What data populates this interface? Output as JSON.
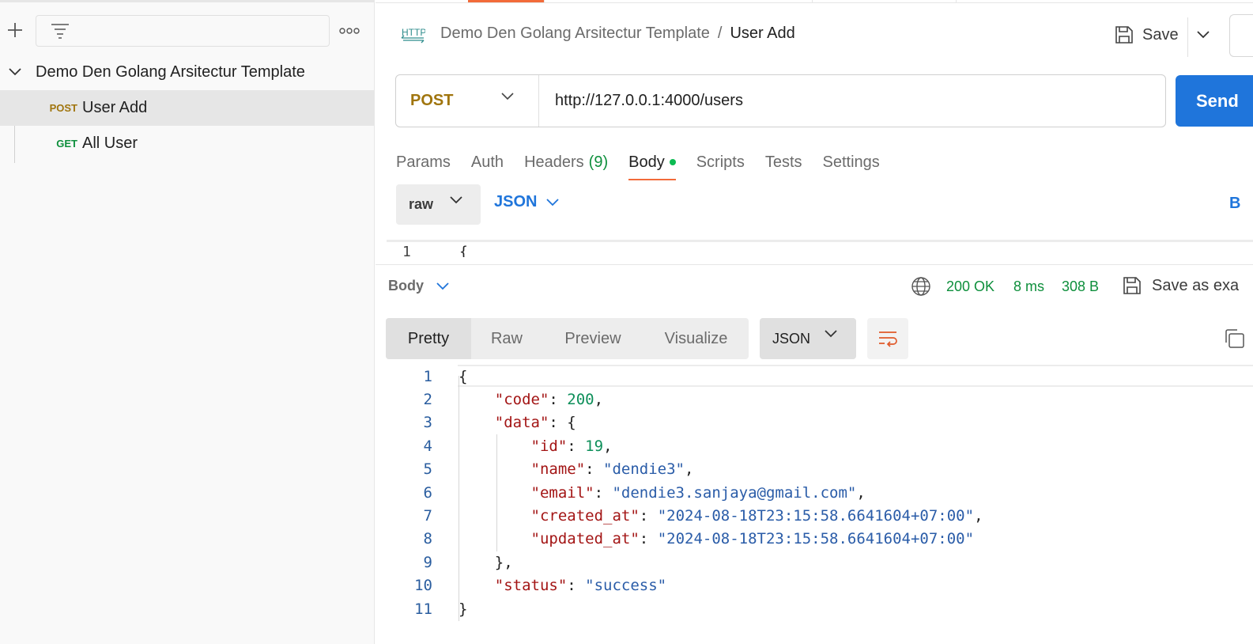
{
  "sidebar": {
    "collection_name": "Demo Den Golang Arsitectur Template",
    "items": [
      {
        "method": "POST",
        "label": "User Add",
        "method_color": "#a0750e"
      },
      {
        "method": "GET",
        "label": "All User",
        "method_color": "#0e8f3c"
      }
    ]
  },
  "header": {
    "breadcrumb_collection": "Demo Den Golang Arsitectur Template",
    "breadcrumb_separator": "/",
    "breadcrumb_request": "User Add",
    "save_label": "Save"
  },
  "request": {
    "method": "POST",
    "url": "http://127.0.0.1:4000/users",
    "send_label": "Send",
    "tabs": [
      {
        "label": "Params"
      },
      {
        "label": "Auth"
      },
      {
        "label": "Headers",
        "count": "(9)"
      },
      {
        "label": "Body"
      },
      {
        "label": "Scripts"
      },
      {
        "label": "Tests"
      },
      {
        "label": "Settings"
      }
    ],
    "body_mode": "raw",
    "body_language": "JSON",
    "beautify_label": "B",
    "editor_line_number": "1",
    "editor_first_char": "{"
  },
  "response": {
    "section_label": "Body",
    "status": "200 OK",
    "time": "8 ms",
    "size": "308 B",
    "save_example_label": "Save as exa",
    "view_tabs": [
      "Pretty",
      "Raw",
      "Preview",
      "Visualize"
    ],
    "format": "JSON",
    "code_lines": [
      {
        "n": "1",
        "t": "{"
      },
      {
        "n": "2",
        "t": "    \"code\": 200,"
      },
      {
        "n": "3",
        "t": "    \"data\": {"
      },
      {
        "n": "4",
        "t": "        \"id\": 19,"
      },
      {
        "n": "5",
        "t": "        \"name\": \"dendie3\","
      },
      {
        "n": "6",
        "t": "        \"email\": \"dendie3.sanjaya@gmail.com\","
      },
      {
        "n": "7",
        "t": "        \"created_at\": \"2024-08-18T23:15:58.6641604+07:00\","
      },
      {
        "n": "8",
        "t": "        \"updated_at\": \"2024-08-18T23:15:58.6641604+07:00\""
      },
      {
        "n": "9",
        "t": "    },"
      },
      {
        "n": "10",
        "t": "    \"status\": \"success\""
      },
      {
        "n": "11",
        "t": "}"
      }
    ]
  },
  "colors": {
    "accent_tab": "#f26b3a",
    "send_blue": "#1f75db",
    "status_green": "#0e8f3c",
    "json_key": "#a31515",
    "json_string": "#2a5ca8",
    "json_number": "#0e8f5a"
  }
}
